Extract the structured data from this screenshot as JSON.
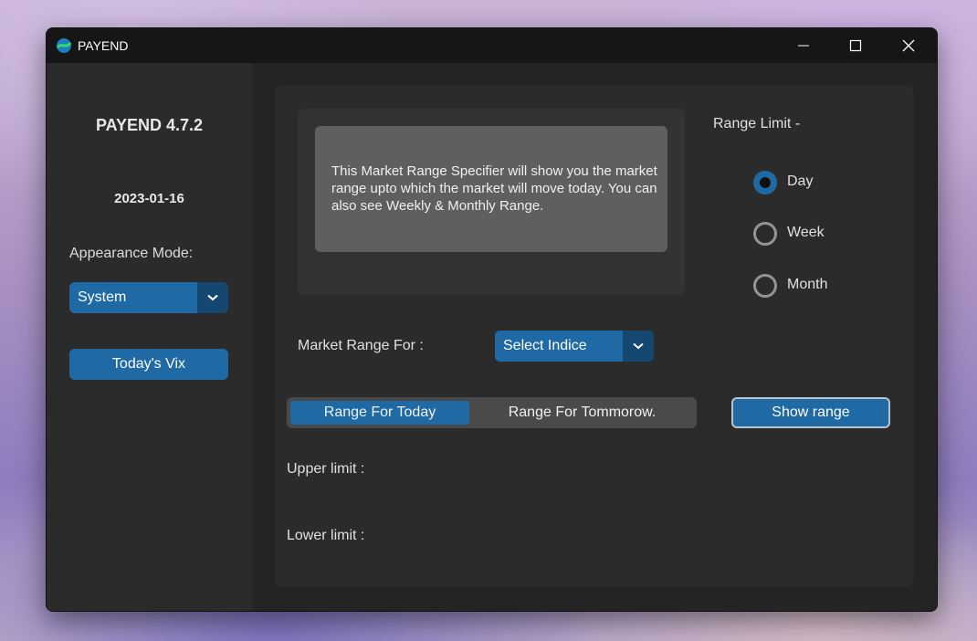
{
  "window": {
    "title": "PAYEND",
    "controls": [
      "minimize-icon",
      "maximize-icon",
      "close-icon"
    ]
  },
  "sidebar": {
    "app_title": "PAYEND 4.7.2",
    "date": "2023-01-16",
    "appearance_label": "Appearance Mode:",
    "appearance_value": "System",
    "vix_button": "Today's Vix"
  },
  "main": {
    "info_text": "This Market Range Specifier will show you the market range upto which the market will move today. You can also see Weekly & Monthly Range.",
    "range_limit_label": "Range Limit -",
    "range_options": [
      {
        "label": "Day",
        "selected": true
      },
      {
        "label": "Week",
        "selected": false
      },
      {
        "label": "Month",
        "selected": false
      }
    ],
    "market_range_label": "Market Range For :",
    "indice_value": "Select Indice",
    "segments": [
      {
        "label": "Range For Today",
        "selected": true
      },
      {
        "label": "Range For Tommorow.",
        "selected": false
      }
    ],
    "show_range_button": "Show range",
    "upper_limit_label": "Upper limit :",
    "lower_limit_label": "Lower limit :"
  },
  "colors": {
    "accent": "#1f6aa5",
    "accent_dark": "#144870",
    "window_bg": "#242424",
    "panel_bg": "#2b2b2b",
    "info_box": "#5f5f5f"
  }
}
